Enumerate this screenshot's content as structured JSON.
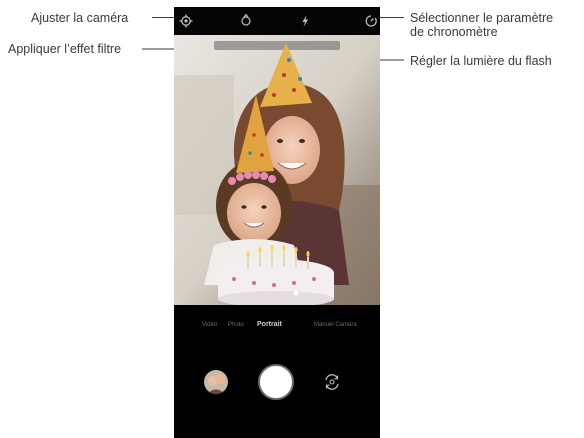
{
  "callouts": {
    "adjust_camera": "Ajuster la caméra",
    "apply_filter": "Appliquer l’effet filtre",
    "timer_line1": "Sélectionner le paramètre",
    "timer_line2": "de chronomètre",
    "flash": "Régler la lumière du flash"
  },
  "camera": {
    "icons": [
      "settings-icon",
      "filter-icon",
      "flash-icon",
      "timer-icon"
    ],
    "modes": [
      "Vidéo",
      "Photo",
      "Portrait",
      "Manuel Caméra"
    ],
    "active_mode": "Portrait"
  },
  "colors": {
    "ui_background": "#000000",
    "callout_line": "#3a3a3a"
  }
}
